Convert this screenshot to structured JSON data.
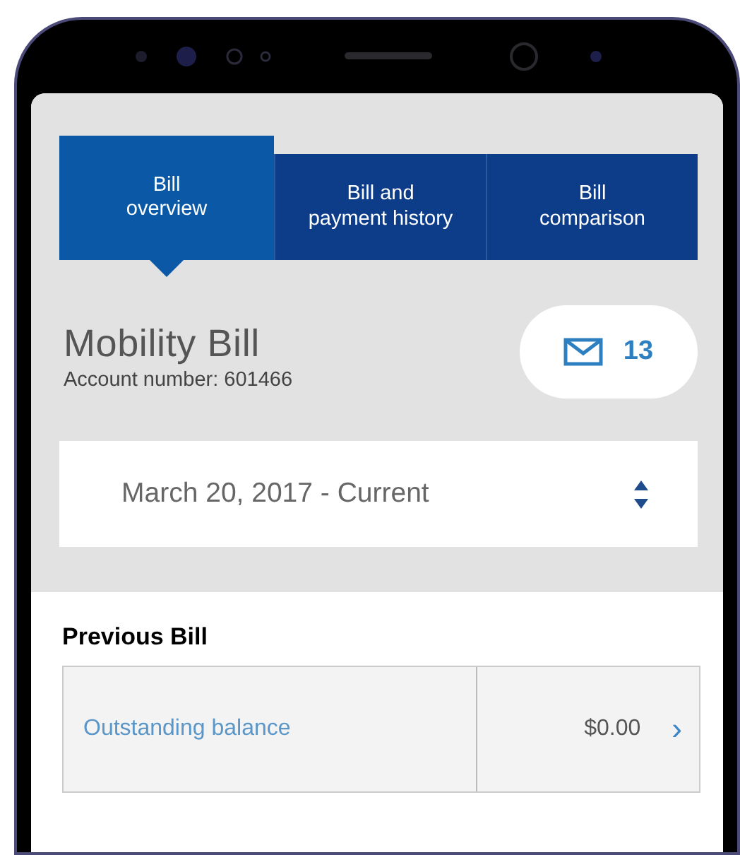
{
  "tabs": [
    {
      "label": "Bill\noverview",
      "selected": true
    },
    {
      "label": "Bill and\npayment history",
      "selected": false
    },
    {
      "label": "Bill\ncomparison",
      "selected": false
    }
  ],
  "header": {
    "title": "Mobility Bill",
    "account": "Account number: 601466",
    "messages": {
      "count": "13"
    }
  },
  "period_select": {
    "value": "March 20, 2017 - Current"
  },
  "previous_bill": {
    "heading": "Previous Bill",
    "rows": [
      {
        "label": "Outstanding balance",
        "amount": "$0.00",
        "chevron": "›"
      }
    ]
  }
}
